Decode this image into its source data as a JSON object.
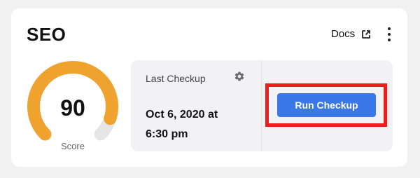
{
  "card": {
    "title": "SEO",
    "docs_label": "Docs",
    "docs_icon": "external-link-icon",
    "menu_icon": "more-vertical-icon"
  },
  "score": {
    "value": "90",
    "label": "Score",
    "fraction": 0.9,
    "colors": {
      "progress": "#f0a22e",
      "track": "#e6e6e6"
    }
  },
  "checkup": {
    "label": "Last Checkup",
    "settings_icon": "gear-icon",
    "date_line1": "Oct 6, 2020 at",
    "date_line2": "6:30 pm",
    "button_label": "Run Checkup",
    "colors": {
      "button": "#3b78e7",
      "highlight": "#ef1c1c"
    }
  }
}
